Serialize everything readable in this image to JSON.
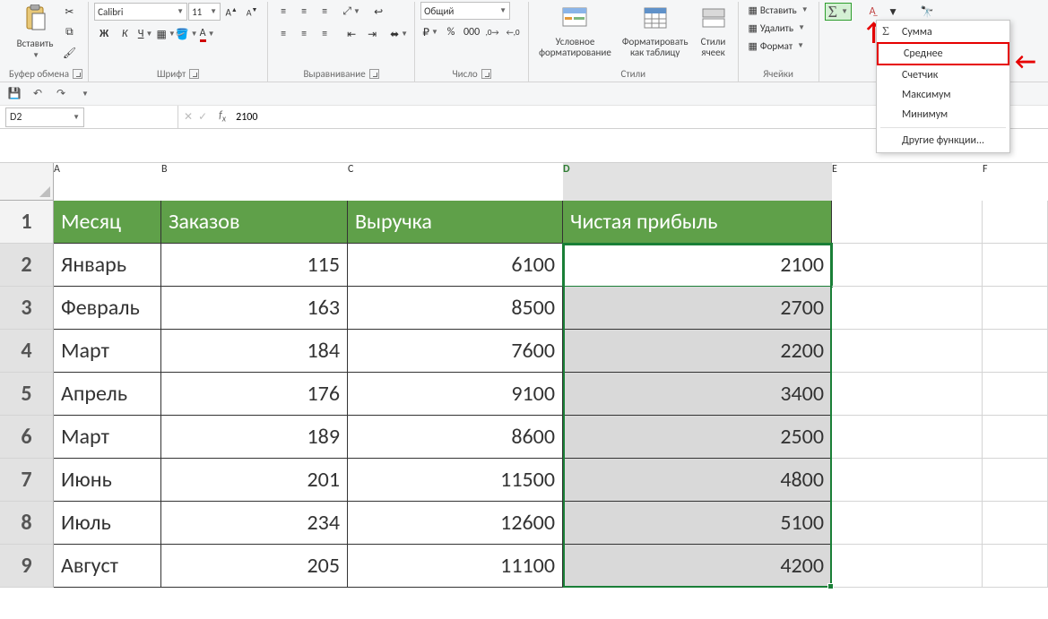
{
  "ribbon": {
    "clipboard": {
      "label": "Буфер обмена",
      "paste": "Вставить"
    },
    "font": {
      "label": "Шрифт",
      "font_name": "Calibri",
      "font_size": "11",
      "bold": "Ж",
      "italic": "К",
      "underline": "Ч"
    },
    "alignment": {
      "label": "Выравнивание"
    },
    "number": {
      "label": "Число",
      "format": "Общий"
    },
    "styles": {
      "label": "Стили",
      "cond": "Условное\nформатирование",
      "table": "Форматировать\nкак таблицу",
      "cellstyles": "Стили\nячеек"
    },
    "cells": {
      "label": "Ячейки",
      "insert": "Вставить",
      "delete": "Удалить",
      "format": "Формат"
    },
    "autosum_menu": {
      "sum": "Сумма",
      "avg": "Среднее",
      "count": "Счетчик",
      "max": "Максимум",
      "min": "Минимум",
      "more": "Другие функции..."
    }
  },
  "namebox": "D2",
  "formula": "2100",
  "columns": [
    "A",
    "B",
    "C",
    "D",
    "E",
    "F"
  ],
  "headers": {
    "A": "Месяц",
    "B": "Заказов",
    "C": "Выручка",
    "D": "Чистая прибыль"
  },
  "rows": [
    {
      "n": "2",
      "A": "Январь",
      "B": "115",
      "C": "6100",
      "D": "2100"
    },
    {
      "n": "3",
      "A": "Февраль",
      "B": "163",
      "C": "8500",
      "D": "2700"
    },
    {
      "n": "4",
      "A": "Март",
      "B": "184",
      "C": "7600",
      "D": "2200"
    },
    {
      "n": "5",
      "A": "Апрель",
      "B": "176",
      "C": "9100",
      "D": "3400"
    },
    {
      "n": "6",
      "A": "Март",
      "B": "189",
      "C": "8600",
      "D": "2500"
    },
    {
      "n": "7",
      "A": "Июнь",
      "B": "201",
      "C": "11500",
      "D": "4800"
    },
    {
      "n": "8",
      "A": "Июль",
      "B": "234",
      "C": "12600",
      "D": "5100"
    },
    {
      "n": "9",
      "A": "Август",
      "B": "205",
      "C": "11100",
      "D": "4200"
    }
  ]
}
